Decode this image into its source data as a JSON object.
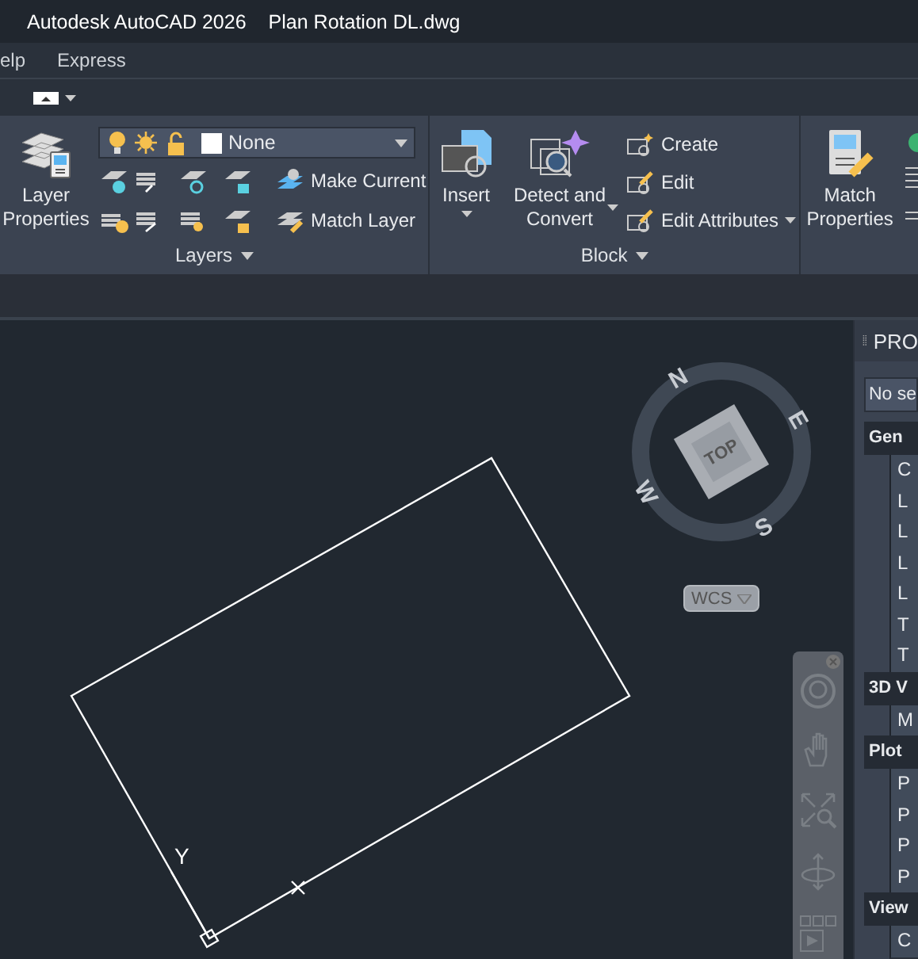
{
  "window": {
    "title": "Autodesk AutoCAD 2026",
    "document": "Plan Rotation DL.dwg"
  },
  "menu": [
    {
      "label": "elp"
    },
    {
      "label": "Express"
    }
  ],
  "layers_panel": {
    "title": "Layers",
    "big_button": "Layer Properties",
    "layer_value": "None",
    "buttons": [
      "Make Current",
      "Match Layer"
    ]
  },
  "block_panel": {
    "title": "Block",
    "big_buttons": [
      {
        "label": "Insert"
      },
      {
        "label": "Detect and Convert"
      }
    ],
    "small_buttons": [
      {
        "label": "Create"
      },
      {
        "label": "Edit"
      },
      {
        "label": "Edit Attributes"
      }
    ]
  },
  "match_panel": {
    "big_button": "Match Properties"
  },
  "viewcube": {
    "face": "TOP",
    "directions": [
      "N",
      "E",
      "S",
      "W"
    ],
    "ucs": "WCS"
  },
  "drawing": {
    "ucs_y_label": "Y"
  },
  "properties": {
    "title": "PRO",
    "selection": "No se",
    "sections": [
      {
        "title": "Gen",
        "rows": [
          "C",
          "L",
          "L",
          "L",
          "L",
          "T",
          "T"
        ]
      },
      {
        "title": "3D V",
        "rows": [
          "M"
        ]
      },
      {
        "title": "Plot",
        "rows": [
          "P",
          "P",
          "P",
          "P"
        ]
      },
      {
        "title": "View",
        "rows": [
          "C"
        ]
      }
    ]
  }
}
